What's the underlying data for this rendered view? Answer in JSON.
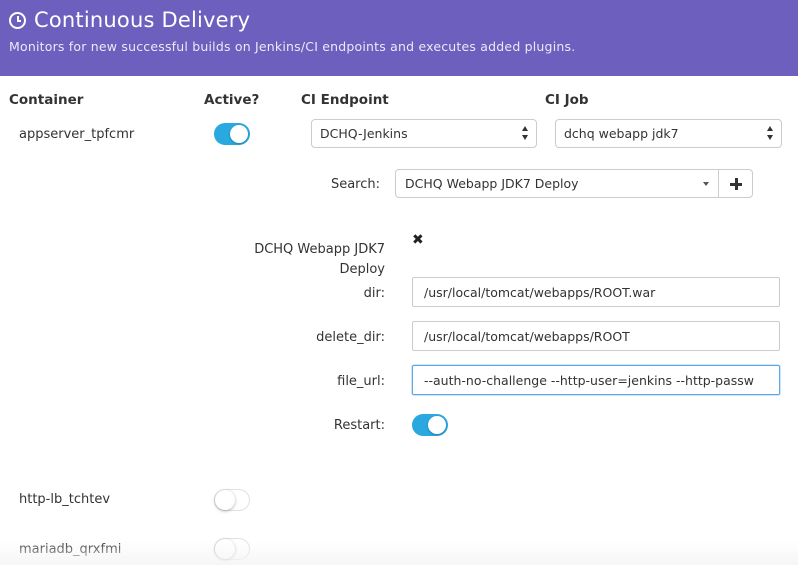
{
  "header": {
    "title": "Continuous Delivery",
    "subtitle": "Monitors for new successful builds on Jenkins/CI endpoints and executes added plugins.",
    "icon": "clock-icon",
    "bg_color": "#6c5fbd"
  },
  "columns": {
    "container": "Container",
    "active": "Active?",
    "ci_endpoint": "CI Endpoint",
    "ci_job": "CI Job"
  },
  "rows": [
    {
      "name": "appserver_tpfcmr",
      "active": true,
      "ci_endpoint": "DCHQ-Jenkins",
      "ci_job": "dchq webapp jdk7"
    },
    {
      "name": "http-lb_tchtev",
      "active": false
    },
    {
      "name": "mariadb_qrxfmi",
      "active": false
    }
  ],
  "search": {
    "label": "Search:",
    "value": "DCHQ Webapp JDK7 Deploy"
  },
  "plugin": {
    "name_line1": "DCHQ Webapp JDK7",
    "name_line2": "Deploy",
    "params": [
      {
        "label": "dir:",
        "value": "/usr/local/tomcat/webapps/ROOT.war"
      },
      {
        "label": "delete_dir:",
        "value": "/usr/local/tomcat/webapps/ROOT"
      },
      {
        "label": "file_url:",
        "value": "--auth-no-challenge --http-user=jenkins --http-passw"
      }
    ],
    "restart_label": "Restart:",
    "restart": true
  },
  "colors": {
    "toggle_on": "#2aa8e0"
  }
}
